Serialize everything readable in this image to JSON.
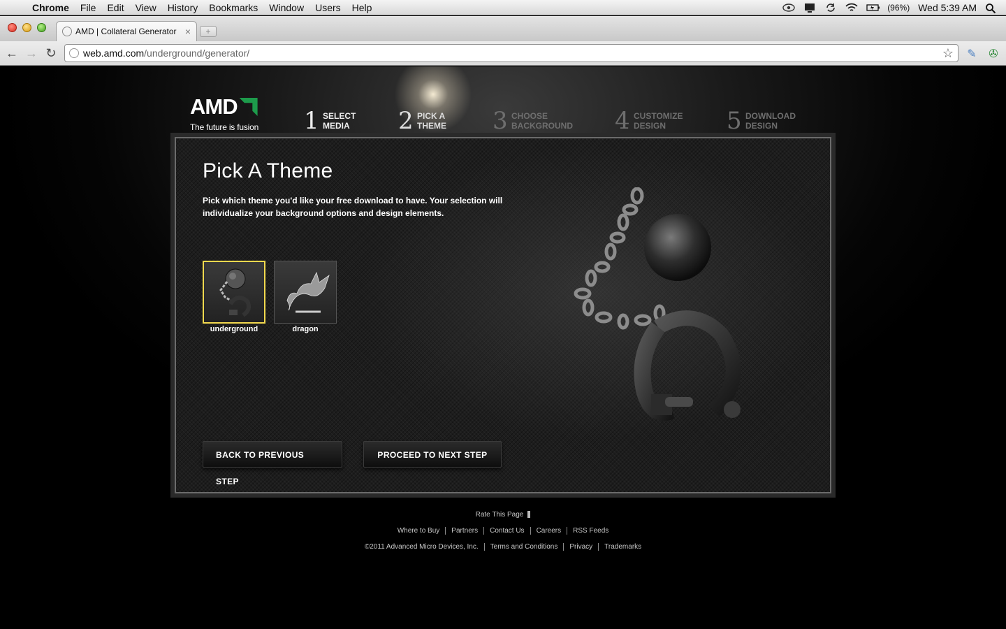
{
  "menubar": {
    "app": "Chrome",
    "items": [
      "File",
      "Edit",
      "View",
      "History",
      "Bookmarks",
      "Window",
      "Users",
      "Help"
    ],
    "battery": "(96%)",
    "clock": "Wed 5:39 AM"
  },
  "browser": {
    "tab_title": "AMD | Collateral Generator",
    "url_host": "web.amd.com",
    "url_path": "/underground/generator/"
  },
  "site": {
    "logo_text": "AMD",
    "tagline": "The future is fusion",
    "steps": [
      {
        "num": "1",
        "line1": "Select",
        "line2": "Media"
      },
      {
        "num": "2",
        "line1": "Pick a",
        "line2": "Theme"
      },
      {
        "num": "3",
        "line1": "Choose",
        "line2": "Background"
      },
      {
        "num": "4",
        "line1": "Customize",
        "line2": "Design"
      },
      {
        "num": "5",
        "line1": "Download",
        "line2": "Design"
      }
    ],
    "title": "Pick A Theme",
    "description": "Pick which theme you'd like your free download to have. Your selection will individualize your background options and design elements.",
    "themes": [
      {
        "name": "underground",
        "selected": true
      },
      {
        "name": "dragon",
        "selected": false
      }
    ],
    "back_button": "Back to Previous Step",
    "next_button": "Proceed to Next Step",
    "accent_color": "#f2d94e"
  },
  "footer": {
    "rate": "Rate This Page",
    "links": [
      "Where to Buy",
      "Partners",
      "Contact Us",
      "Careers",
      "RSS Feeds"
    ],
    "copyright": "©2011 Advanced Micro Devices, Inc.",
    "legal": [
      "Terms and Conditions",
      "Privacy",
      "Trademarks"
    ]
  }
}
